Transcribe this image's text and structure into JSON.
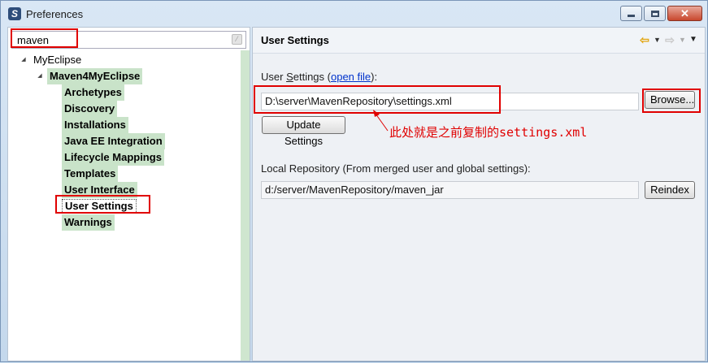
{
  "window": {
    "title": "Preferences"
  },
  "filter": {
    "value": "maven"
  },
  "tree": {
    "root": "MyEclipse",
    "group": "Maven4MyEclipse",
    "items": [
      "Archetypes",
      "Discovery",
      "Installations",
      "Java EE Integration",
      "Lifecycle Mappings",
      "Templates",
      "User Interface",
      "User Settings",
      "Warnings"
    ],
    "selected": "User Settings"
  },
  "page": {
    "title": "User Settings",
    "user_settings_label_pre": "User ",
    "user_settings_label_ul": "S",
    "user_settings_label_post": "ettings (",
    "open_file_link": "open file",
    "user_settings_label_end": "):",
    "user_settings_value": "D:\\server\\MavenRepository\\settings.xml",
    "browse_label": "Browse...",
    "update_label": "Update Settings",
    "local_repo_label": "Local Repository (From merged user and global settings):",
    "local_repo_value": "d:/server/MavenRepository/maven_jar",
    "reindex_label": "Reindex"
  },
  "annotation": {
    "text": "此处就是之前复制的settings.xml",
    "color": "#e00000"
  },
  "colors": {
    "highlight": "#e00000",
    "match_bg": "#c9e3c9"
  }
}
